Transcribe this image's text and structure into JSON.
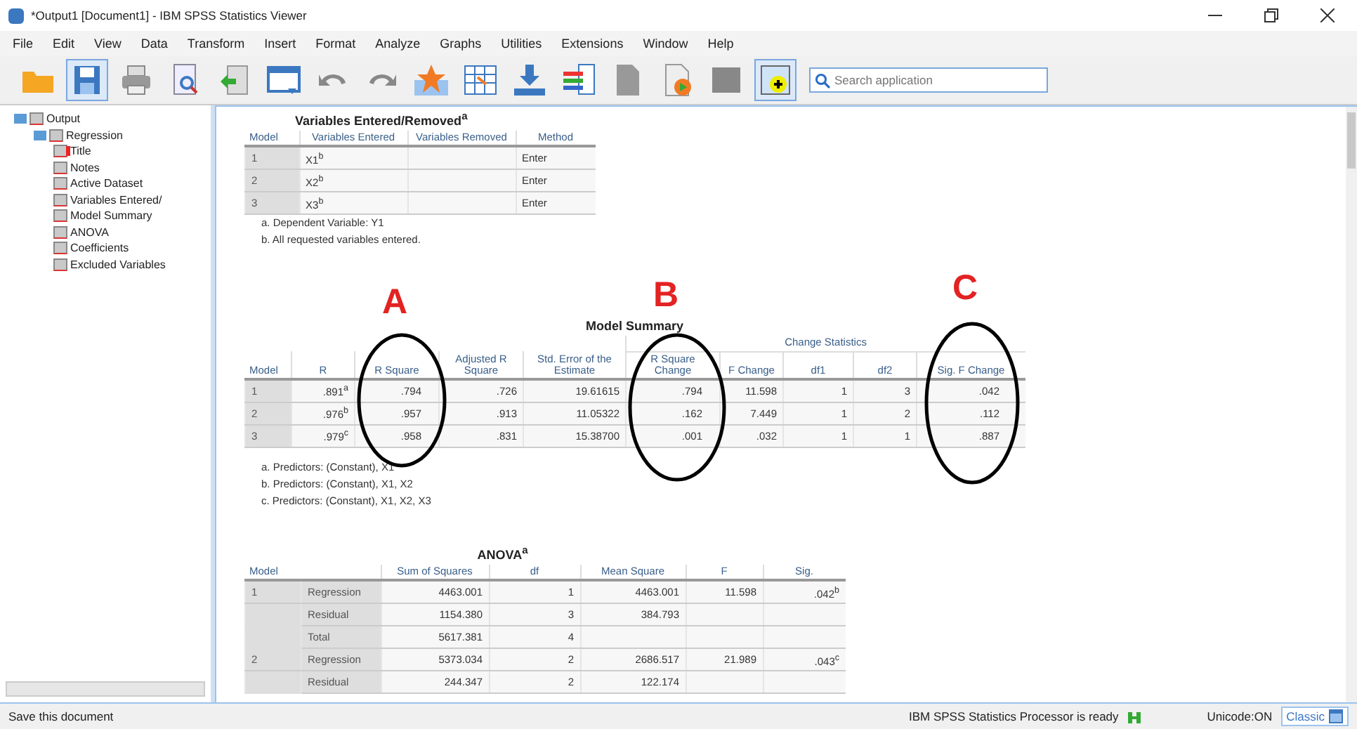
{
  "window": {
    "title": "*Output1 [Document1] - IBM SPSS Statistics Viewer"
  },
  "menu": [
    "File",
    "Edit",
    "View",
    "Data",
    "Transform",
    "Insert",
    "Format",
    "Analyze",
    "Graphs",
    "Utilities",
    "Extensions",
    "Window",
    "Help"
  ],
  "search": {
    "placeholder": "Search application"
  },
  "outline": [
    {
      "label": "Output",
      "selected": false,
      "children": [
        {
          "label": "Regression",
          "selected": false,
          "children": [
            {
              "label": "Title",
              "selected": true
            },
            {
              "label": "Notes",
              "selected": false
            },
            {
              "label": "Active Dataset",
              "selected": false
            },
            {
              "label": "Variables Entered/",
              "selected": false
            },
            {
              "label": "Model Summary",
              "selected": false
            },
            {
              "label": "ANOVA",
              "selected": false
            },
            {
              "label": "Coefficients",
              "selected": false
            },
            {
              "label": "Excluded Variables",
              "selected": false
            }
          ]
        }
      ]
    }
  ],
  "variables_table": {
    "title": "Variables Entered/Removed$^{a}$",
    "columns": [
      "Model",
      "Variables Entered",
      "Variables Removed",
      "Method"
    ],
    "rows": [
      [
        "1",
        "X1$^{b}$",
        "",
        "Enter"
      ],
      [
        "2",
        "X2$^{b}$",
        "",
        "Enter"
      ],
      [
        "3",
        "X3$^{b}$",
        "",
        "Enter"
      ]
    ],
    "footnotes": [
      "a. Dependent Variable: Y1",
      "b. All requested variables entered."
    ]
  },
  "model_summary": {
    "title": "Model Summary",
    "group_header": "Change Statistics",
    "columns": [
      "Model",
      "R",
      "R Square",
      "Adjusted R Square",
      "Std. Error of the Estimate",
      "R Square Change",
      "F Change",
      "df1",
      "df2",
      "Sig. F Change"
    ],
    "rows": [
      [
        "1",
        ".891$^{a}$",
        ".794",
        ".726",
        "19.61615",
        ".794",
        "11.598",
        "1",
        "3",
        ".042"
      ],
      [
        "2",
        ".976$^{b}$",
        ".957",
        ".913",
        "11.05322",
        ".162",
        "7.449",
        "1",
        "2",
        ".112"
      ],
      [
        "3",
        ".979$^{c}$",
        ".958",
        ".831",
        "15.38700",
        ".001",
        ".032",
        "1",
        "1",
        ".887"
      ]
    ],
    "footnotes": [
      "a. Predictors: (Constant), X1",
      "b. Predictors: (Constant), X1, X2",
      "c. Predictors: (Constant), X1, X2, X3"
    ]
  },
  "annotations": [
    "A",
    "B",
    "C"
  ],
  "anova": {
    "title": "ANOVA$^{a}$",
    "columns": [
      "Model",
      "",
      "Sum of Squares",
      "df",
      "Mean Square",
      "F",
      "Sig."
    ],
    "rows": [
      [
        "1",
        "Regression",
        "4463.001",
        "1",
        "4463.001",
        "11.598",
        ".042$^{b}$"
      ],
      [
        "",
        "Residual",
        "1154.380",
        "3",
        "384.793",
        "",
        ""
      ],
      [
        "",
        "Total",
        "5617.381",
        "4",
        "",
        "",
        ""
      ],
      [
        "2",
        "Regression",
        "5373.034",
        "2",
        "2686.517",
        "21.989",
        ".043$^{c}$"
      ],
      [
        "",
        "Residual",
        "244.347",
        "2",
        "122.174",
        "",
        ""
      ]
    ]
  },
  "status_bar": {
    "message": "Save this document",
    "processor": "IBM SPSS Statistics Processor is ready",
    "unicode": "Unicode:ON",
    "mode": "Classic"
  }
}
